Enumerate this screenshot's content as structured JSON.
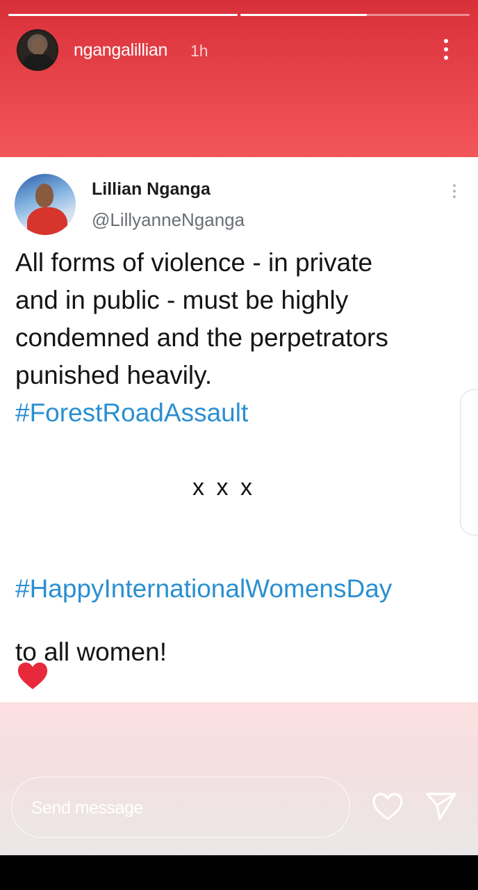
{
  "story": {
    "username": "ngangalillian",
    "time_ago": "1h",
    "progress": [
      1.0,
      0.55
    ]
  },
  "tweet": {
    "author_name": "Lillian Nganga",
    "author_handle": "@LillyanneNganga",
    "text_lines": [
      "All forms of violence - in private",
      "and in public - must be highly",
      "condemned and the perpetrators",
      "punished heavily."
    ],
    "hashtag1": "#ForestRoadAssault",
    "separator": "x x x",
    "hashtag2": "#HappyInternationalWomensDay",
    "closing": "to all women!"
  },
  "reply": {
    "placeholder": "Send message"
  },
  "icons": {
    "menu": "more-vertical-icon",
    "tweet_menu": "more-vertical-icon",
    "sticker": "heart-icon",
    "like": "heart-outline-icon",
    "share": "paper-plane-icon"
  },
  "colors": {
    "story_top": "#d8303a",
    "hashtag": "#2a8fd1",
    "heart": "#e8293b"
  }
}
